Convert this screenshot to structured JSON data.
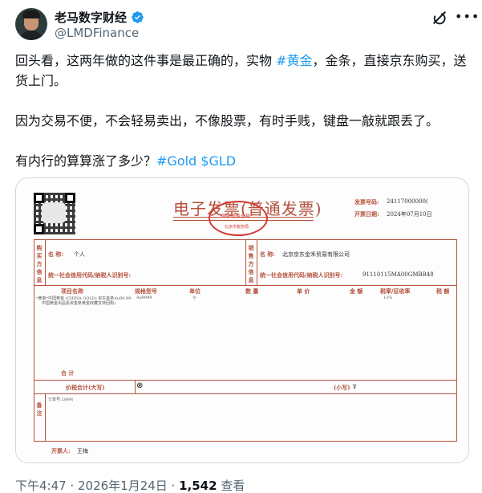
{
  "author": {
    "display_name": "老马数字财经",
    "handle": "@LMDFinance",
    "avatar_icon": "avatar-photo",
    "verified_color": "#1d9bf0"
  },
  "tweet": {
    "para1_prefix": "回头看，这两年做的这件事是最正确的，实物 ",
    "para1_tag": "#黄金",
    "para1_suffix": "，金条，直接京东购买，送货上门。",
    "para2": "因为交易不便，不会轻易卖出，不像股票，有时手贱，键盘一敲就跟丢了。",
    "para3_prefix": "有内行的算算涨了多少？",
    "para3_tag1": "#Gold",
    "para3_tag2": "$GLD"
  },
  "invoice": {
    "title": "电子发票(普通发票)",
    "stamp_line1": "国家税务总局",
    "stamp_line2": "北京市税务局",
    "invoice_no_label": "发票号码:",
    "invoice_no": "24117000000(",
    "date_label": "开票日期:",
    "date": "2024年07月10日",
    "buyer_side": "购买方信息",
    "buyer_name_label": "名  称:",
    "buyer_name": "个人",
    "buyer_tax_label": "统一社会信用代码/纳税人识别号:",
    "seller_side": "销售方信息",
    "seller_name_label": "名  称:",
    "seller_name": "北京京东金禾贸易有限公司",
    "seller_tax_label": "统一社会信用代码/纳税人识别号:",
    "seller_tax": "91110115MA00GMBB48",
    "col_item": "项目名称",
    "col_spec": "规格型号",
    "col_unit": "单位",
    "col_qty": "数 量",
    "col_price": "单 价",
    "col_amount": "金 额",
    "col_rate": "税率/征收率",
    "col_tax": "税 额",
    "item_line1": "*黄金*中国黄金 (CHINA GOLD) 京东金条Au99.99",
    "item_line2": "中国黄金出品投资金条黄金收藏支持回购)",
    "item_spec": "Au9999",
    "item_unit": "个",
    "item_rate": "13%",
    "total_label": "合  计",
    "grand_total_label": "价税合计(大写)",
    "grand_total_small_label": "(小写)",
    "grand_total_small": "¥",
    "remarks_label": "备注",
    "remarks_text": "订单号:2849(",
    "issuer_label": "开票人:",
    "issuer": "王梅"
  },
  "footer": {
    "time": "下午4:47 · 2026年1月24日 · ",
    "views_count": "1,542",
    "views_label": " 查看"
  }
}
